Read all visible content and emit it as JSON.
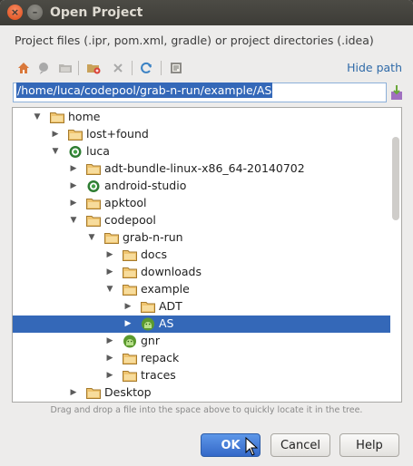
{
  "window": {
    "title": "Open Project",
    "close_glyph": "×",
    "minimize_glyph": "–"
  },
  "description": "Project files (.ipr, pom.xml, gradle) or project directories (.idea)",
  "toolbar": {
    "icons": [
      "home-icon",
      "desktop-icon",
      "project-icon",
      "new-folder-icon",
      "delete-icon",
      "refresh-icon",
      "show-hidden-icon"
    ],
    "hide_path_label": "Hide path"
  },
  "path": {
    "value": "/home/luca/codepool/grab-n-run/example/AS"
  },
  "tree": {
    "rows": [
      {
        "label": "home",
        "depth": 1,
        "expanded": true,
        "icon": "folder"
      },
      {
        "label": "lost+found",
        "depth": 2,
        "expanded": false,
        "icon": "folder"
      },
      {
        "label": "luca",
        "depth": 2,
        "expanded": true,
        "icon": "android-studio"
      },
      {
        "label": "adt-bundle-linux-x86_64-20140702",
        "depth": 3,
        "expanded": false,
        "icon": "folder"
      },
      {
        "label": "android-studio",
        "depth": 3,
        "expanded": false,
        "icon": "android-studio"
      },
      {
        "label": "apktool",
        "depth": 3,
        "expanded": false,
        "icon": "folder"
      },
      {
        "label": "codepool",
        "depth": 3,
        "expanded": true,
        "icon": "folder"
      },
      {
        "label": "grab-n-run",
        "depth": 4,
        "expanded": true,
        "icon": "folder"
      },
      {
        "label": "docs",
        "depth": 5,
        "expanded": false,
        "icon": "folder"
      },
      {
        "label": "downloads",
        "depth": 5,
        "expanded": false,
        "icon": "folder"
      },
      {
        "label": "example",
        "depth": 5,
        "expanded": true,
        "icon": "folder"
      },
      {
        "label": "ADT",
        "depth": 6,
        "expanded": false,
        "icon": "folder"
      },
      {
        "label": "AS",
        "depth": 6,
        "expanded": false,
        "icon": "android",
        "selected": true
      },
      {
        "label": "gnr",
        "depth": 5,
        "expanded": false,
        "icon": "android"
      },
      {
        "label": "repack",
        "depth": 5,
        "expanded": false,
        "icon": "folder"
      },
      {
        "label": "traces",
        "depth": 5,
        "expanded": false,
        "icon": "folder"
      },
      {
        "label": "Desktop",
        "depth": 3,
        "expanded": false,
        "icon": "folder"
      }
    ]
  },
  "hint": "Drag and drop a file into the space above to quickly locate it in the tree.",
  "buttons": {
    "ok": "OK",
    "cancel": "Cancel",
    "help": "Help"
  },
  "colors": {
    "selection": "#3468b8",
    "folder": "#d9a95a",
    "android_green": "#6aa83a",
    "link": "#2f6aa8"
  }
}
